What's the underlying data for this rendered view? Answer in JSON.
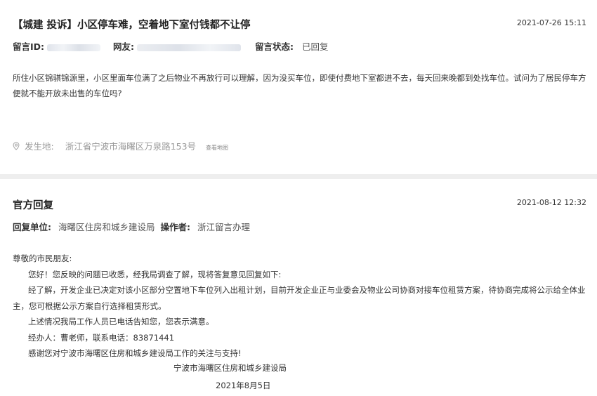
{
  "message": {
    "title": "【城建 投诉】小区停车难，空着地下室付钱都不让停",
    "date": "2021-07-26 15:11",
    "id_label": "留言ID:",
    "user_label": "网友:",
    "status_label": "留言状态:",
    "status_value": "已回复",
    "content": "所住小区锦骐锦源里，小区里面车位满了之后物业不再放行可以理解，因为没买车位，即使付费地下室都进不去，每天回来晚都到处找车位。试问为了居民停车方便就不能开放未出售的车位吗?",
    "location_label": "发生地:",
    "location_value": "浙江省宁波市海曙区万泉路153号",
    "map_link": "查看地图"
  },
  "reply": {
    "heading": "官方回复",
    "date": "2021-08-12 12:32",
    "unit_label": "回复单位:",
    "unit_value": "海曙区住房和城乡建设局",
    "operator_label": "操作者:",
    "operator_value": "浙江留言办理",
    "greeting": "尊敬的市民朋友:",
    "p1": "您好！您反映的问题已收悉，经我局调查了解，现将答复意见回复如下:",
    "p2": "经了解，开发企业已决定对该小区部分空置地下车位列入出租计划，目前开发企业正与业委会及物业公司协商对接车位租赁方案，待协商完成将公示给全体业主，您可根据公示方案自行选择租赁形式。",
    "p3": "上述情况我局工作人员已电话告知您，您表示满意。",
    "p4": "经办人：曹老师，联系电话：83871441",
    "p5": "感谢您对宁波市海曙区住房和城乡建设局工作的关注与支持!",
    "signature": "宁波市海曙区住房和城乡建设局",
    "sign_date": "2021年8月5日"
  }
}
